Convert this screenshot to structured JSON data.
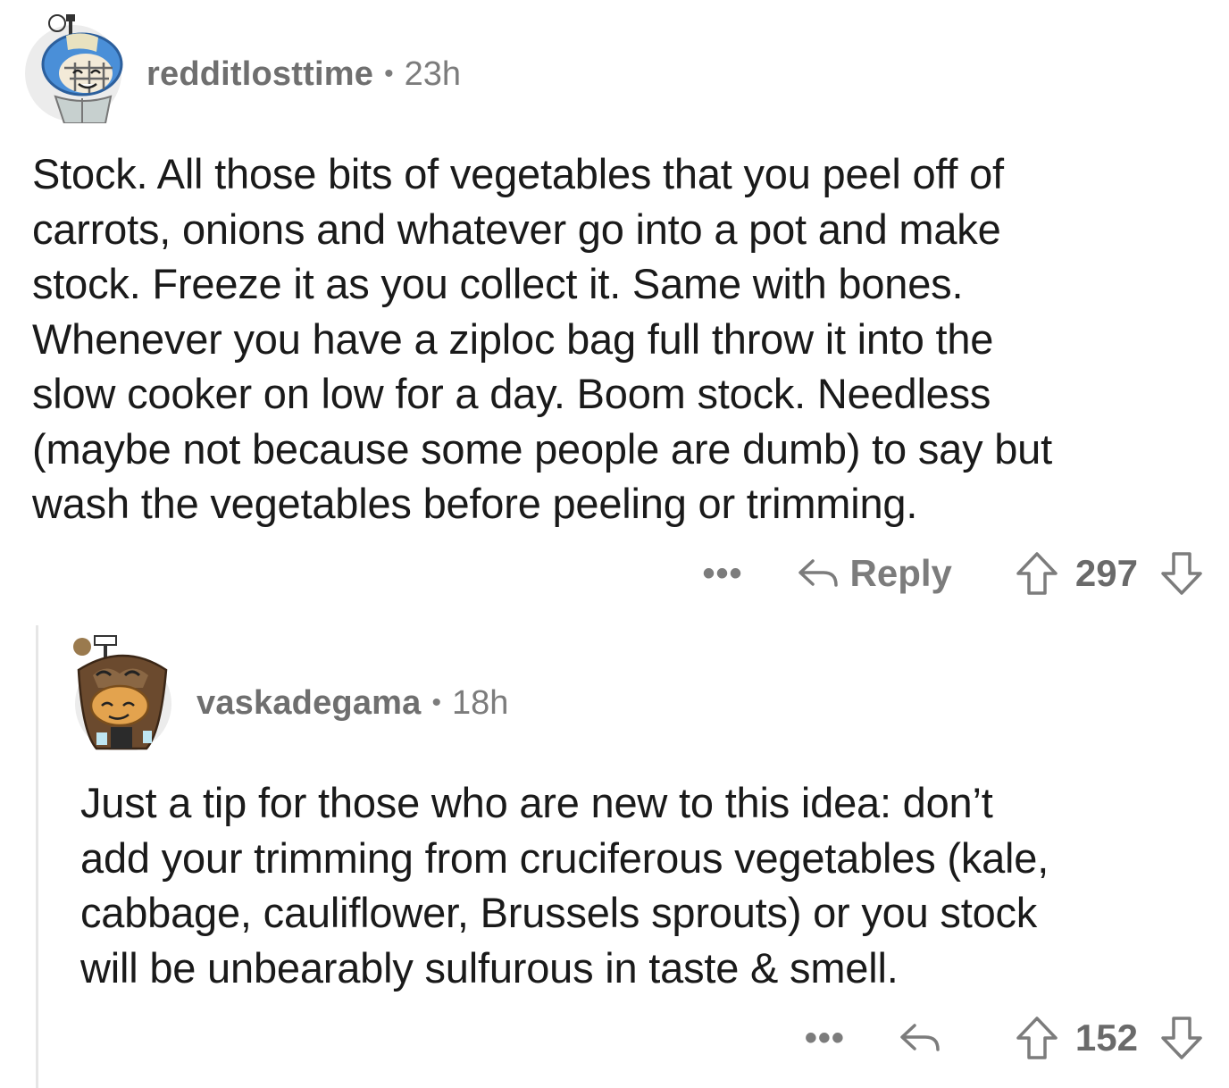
{
  "comments": [
    {
      "username": "redditlosttime",
      "separator": "•",
      "age": "23h",
      "body": "Stock. All those bits of vegetables that you peel off of\ncarrots, onions and whatever go into a pot and make\nstock. Freeze it as you collect  it.  Same with bones.\nWhenever you have a ziploc bag full throw it into the\nslow cooker on low for a day. Boom stock. Needless\n(maybe not because some people are dumb) to say but\nwash the vegetables before peeling or trimming.",
      "more": "•••",
      "reply_label": "Reply",
      "score": "297"
    },
    {
      "username": "vaskadegama",
      "separator": "•",
      "age": "18h",
      "body": "Just a tip for those who are new to this idea: don’t\nadd your trimming from cruciferous vegetables (kale,\ncabbage, cauliflower, Brussels sprouts) or you stock\nwill be unbearably sulfurous in taste & smell.",
      "more": "•••",
      "score": "152"
    }
  ],
  "icons": {
    "reply": "reply-arrow-icon",
    "upvote": "upvote-arrow-icon",
    "downvote": "downvote-arrow-icon",
    "more": "more-options-icon"
  },
  "colors": {
    "meta_text": "#7c7c7c",
    "body_text": "#1a1a1a",
    "thread_line": "#e6e6e6"
  }
}
